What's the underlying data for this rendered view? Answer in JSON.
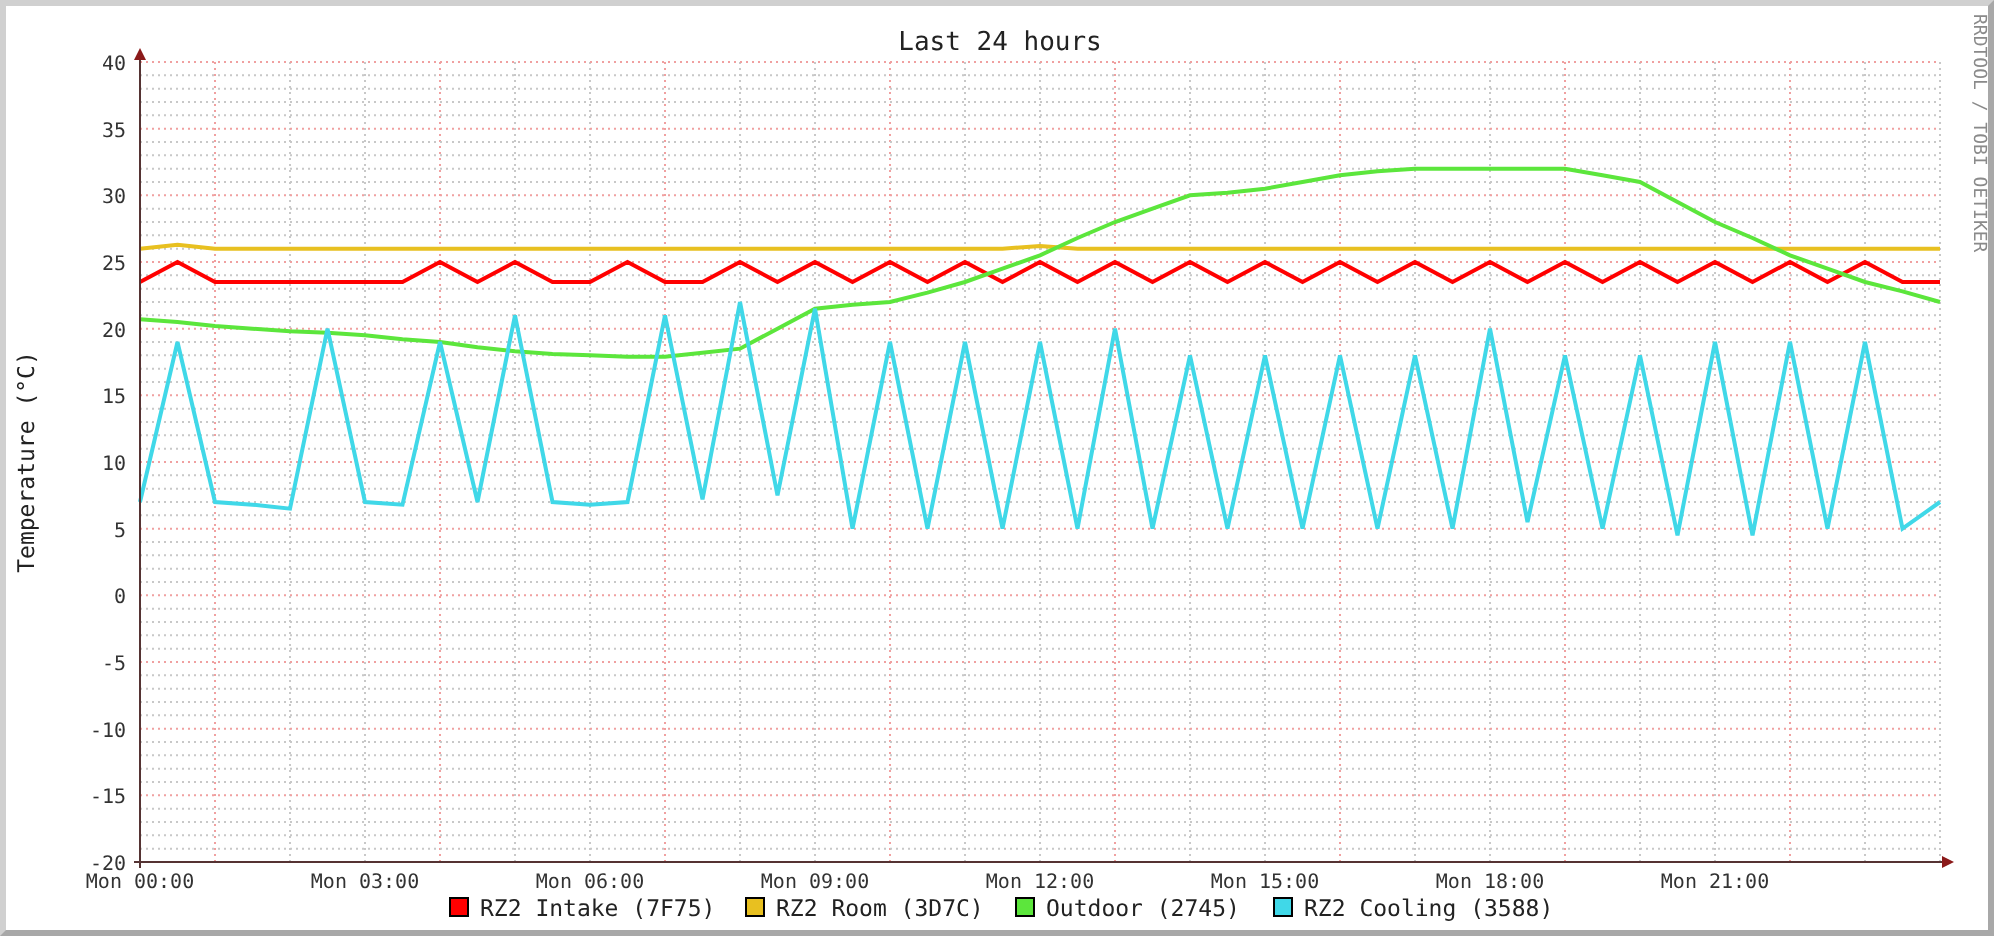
{
  "side_text": "RRDTOOL / TOBI OETIKER",
  "chart_data": {
    "type": "line",
    "title": "Last 24 hours",
    "ylabel": "Temperature (°C)",
    "categories": [
      "Mon 00:00",
      null,
      null,
      null,
      null,
      null,
      "Mon 03:00",
      null,
      null,
      null,
      null,
      null,
      "Mon 06:00",
      null,
      null,
      null,
      null,
      null,
      "Mon 09:00",
      null,
      null,
      null,
      null,
      null,
      "Mon 12:00",
      null,
      null,
      null,
      null,
      null,
      "Mon 15:00",
      null,
      null,
      null,
      null,
      null,
      "Mon 18:00",
      null,
      null,
      null,
      null,
      null,
      "Mon 21:00",
      null,
      null,
      null,
      null,
      null,
      null
    ],
    "ylim": [
      -20,
      40
    ],
    "grid": true,
    "legend": true,
    "yticks": [
      -20,
      -15,
      -10,
      -5,
      0,
      5,
      10,
      15,
      20,
      25,
      30,
      35,
      40
    ],
    "series": [
      {
        "name": "RZ2 Intake (7F75)",
        "color": "#ff0000",
        "values": [
          23.5,
          25,
          23.5,
          23.5,
          23.5,
          23.5,
          23.5,
          23.5,
          25,
          23.5,
          25,
          23.5,
          23.5,
          25,
          23.5,
          23.5,
          25,
          23.5,
          25,
          23.5,
          25,
          23.5,
          25,
          23.5,
          25,
          23.5,
          25,
          23.5,
          25,
          23.5,
          25,
          23.5,
          25,
          23.5,
          25,
          23.5,
          25,
          23.5,
          25,
          23.5,
          25,
          23.5,
          25,
          23.5,
          25,
          23.5,
          25,
          23.5,
          23.5
        ]
      },
      {
        "name": "RZ2 Room (3D7C)",
        "color": "#e8c020",
        "values": [
          26,
          26.3,
          26,
          26,
          26,
          26,
          26,
          26,
          26,
          26,
          26,
          26,
          26,
          26,
          26,
          26,
          26,
          26,
          26,
          26,
          26,
          26,
          26,
          26,
          26.2,
          26,
          26,
          26,
          26,
          26,
          26,
          26,
          26,
          26,
          26,
          26,
          26,
          26,
          26,
          26,
          26,
          26,
          26,
          26,
          26,
          26,
          26,
          26,
          26
        ]
      },
      {
        "name": "Outdoor (2745)",
        "color": "#5ce63c",
        "values": [
          20.7,
          20.5,
          20.2,
          20,
          19.8,
          19.7,
          19.5,
          19.2,
          19,
          18.6,
          18.3,
          18.1,
          18,
          17.9,
          17.9,
          18.2,
          18.5,
          20,
          21.5,
          21.8,
          22,
          22.7,
          23.5,
          24.5,
          25.5,
          26.8,
          28,
          29,
          30,
          30.2,
          30.5,
          31,
          31.5,
          31.8,
          32,
          32,
          32,
          32,
          32,
          31.5,
          31,
          29.5,
          28,
          26.8,
          25.5,
          24.5,
          23.5,
          22.8,
          22
        ]
      },
      {
        "name": "RZ2 Cooling (3588)",
        "color": "#40d8e8",
        "values": [
          7,
          19,
          7,
          6.8,
          6.5,
          20,
          7,
          6.8,
          19,
          7,
          21,
          7,
          6.8,
          7,
          21,
          7.2,
          22,
          7.5,
          21.5,
          5,
          19,
          5,
          19,
          5,
          19,
          5,
          20,
          5,
          18,
          5,
          18,
          5,
          18,
          5,
          18,
          5,
          20,
          5.5,
          18,
          5,
          18,
          4.5,
          19,
          4.5,
          19,
          5,
          19,
          5,
          7
        ]
      }
    ]
  }
}
